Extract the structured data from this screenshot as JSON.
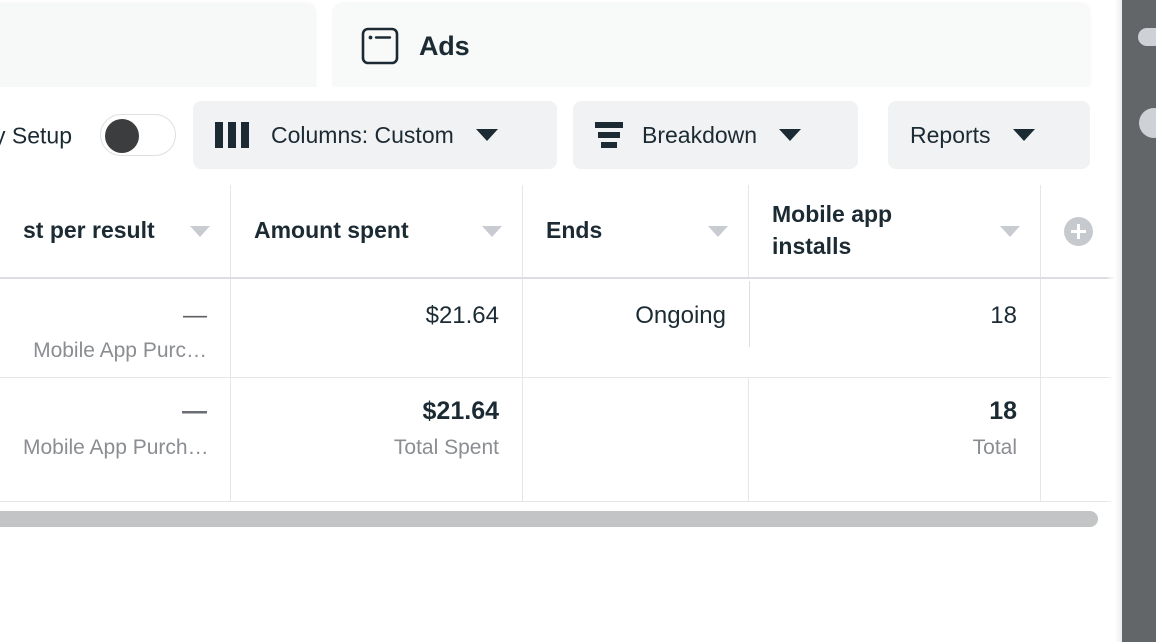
{
  "tabs": {
    "left_tab": {
      "label": ""
    },
    "active_tab": {
      "label": "Ads",
      "icon": "ads-window-icon"
    }
  },
  "toolbar": {
    "setup_label": "y Setup",
    "setup_toggle": {
      "name": "view-setup-toggle",
      "state": "off"
    },
    "columns_button": {
      "label": "Columns: Custom",
      "icon": "columns-icon"
    },
    "breakdown_button": {
      "label": "Breakdown",
      "icon": "breakdown-icon"
    },
    "reports_button": {
      "label": "Reports"
    }
  },
  "table": {
    "columns": [
      {
        "key": "cost_per_result",
        "header": "st per result"
      },
      {
        "key": "amount_spent",
        "header": "Amount spent"
      },
      {
        "key": "ends",
        "header": "Ends"
      },
      {
        "key": "mobile_app_installs",
        "header": "Mobile app installs"
      }
    ],
    "add_column_button": {
      "icon": "plus-circle-icon"
    },
    "rows": [
      {
        "cost_per_result": {
          "value": "—",
          "sub": "Mobile App Purc…"
        },
        "amount_spent": {
          "value": "$21.64",
          "sub": ""
        },
        "ends": {
          "value": "Ongoing",
          "sub": ""
        },
        "mobile_app_installs": {
          "value": "18",
          "sub": ""
        }
      }
    ],
    "totals": {
      "cost_per_result": {
        "value": "—",
        "sub": "Mobile App Purch…"
      },
      "amount_spent": {
        "value": "$21.64",
        "sub": "Total Spent"
      },
      "ends": {
        "value": "",
        "sub": ""
      },
      "mobile_app_installs": {
        "value": "18",
        "sub": "Total"
      }
    }
  },
  "scrollbars": {
    "horizontal": {
      "name": "horizontal-scrollbar"
    },
    "right_panel_vertical": {
      "name": "vertical-scrollbar"
    }
  },
  "colors": {
    "text": "#1c2b33",
    "muted": "#8a8d91",
    "button_bg": "#f1f2f3",
    "border": "#e4e6e9",
    "right_panel": "#636669",
    "scroll_thumb": "#c2c4c6"
  }
}
